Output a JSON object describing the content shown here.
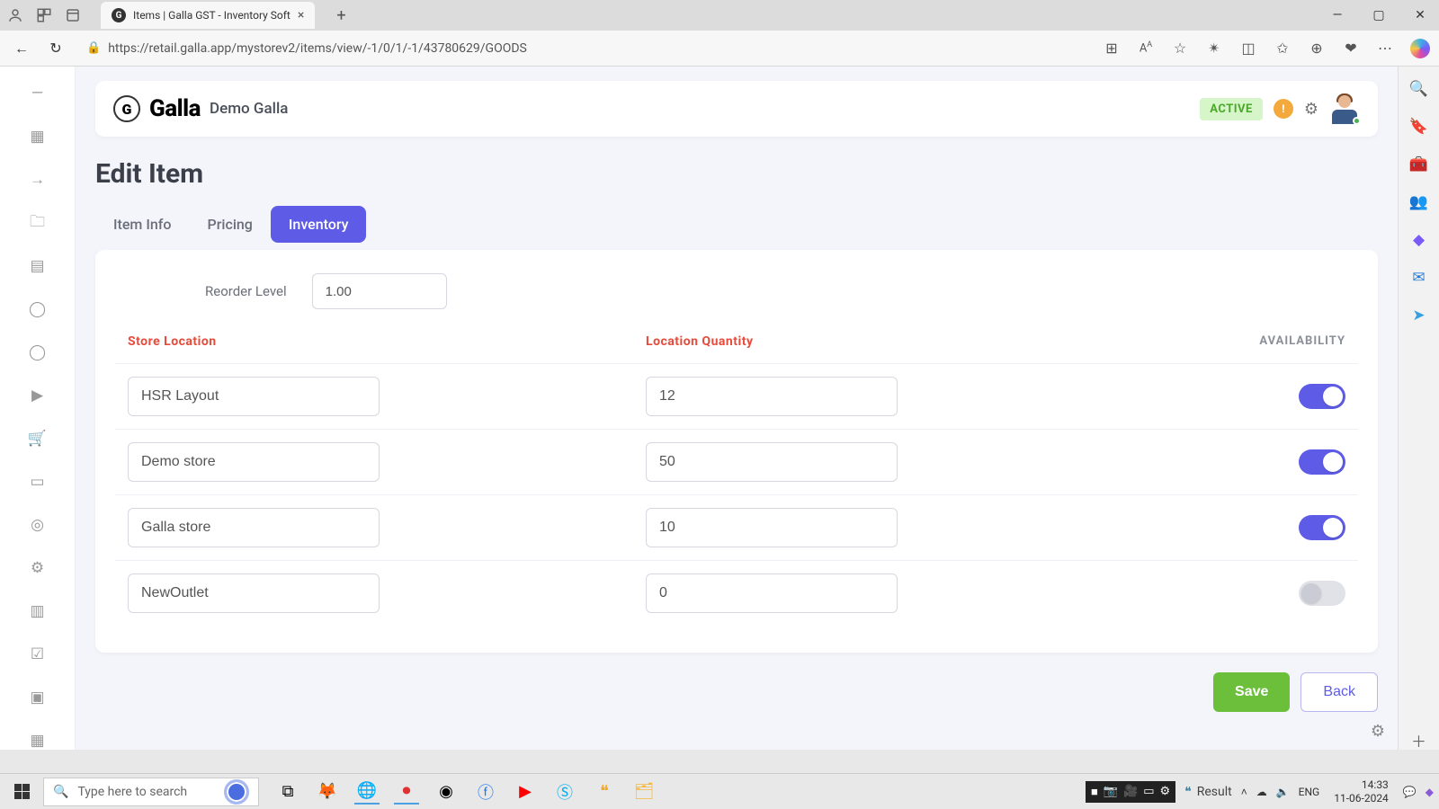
{
  "browser": {
    "tab_title": "Items | Galla GST - Inventory Soft",
    "url": "https://retail.galla.app/mystorev2/items/view/-1/0/1/-1/43780629/GOODS"
  },
  "header": {
    "brand": "Galla",
    "store_name": "Demo Galla",
    "status_badge": "ACTIVE"
  },
  "page": {
    "title": "Edit Item",
    "tabs": [
      {
        "label": "Item Info",
        "active": false
      },
      {
        "label": "Pricing",
        "active": false
      },
      {
        "label": "Inventory",
        "active": true
      }
    ]
  },
  "inventory": {
    "reorder_label": "Reorder Level",
    "reorder_value": "1.00",
    "columns": {
      "location": "Store Location",
      "quantity": "Location Quantity",
      "availability": "AVAILABILITY"
    },
    "rows": [
      {
        "location": "HSR Layout",
        "quantity": "12",
        "available": true
      },
      {
        "location": "Demo store",
        "quantity": "50",
        "available": true
      },
      {
        "location": "Galla store",
        "quantity": "10",
        "available": true
      },
      {
        "location": "NewOutlet",
        "quantity": "0",
        "available": false
      }
    ]
  },
  "buttons": {
    "save": "Save",
    "back": "Back"
  },
  "taskbar": {
    "search_placeholder": "Type here to search",
    "result_label": "Result",
    "lang": "ENG",
    "time": "14:33",
    "date": "11-06-2024"
  }
}
